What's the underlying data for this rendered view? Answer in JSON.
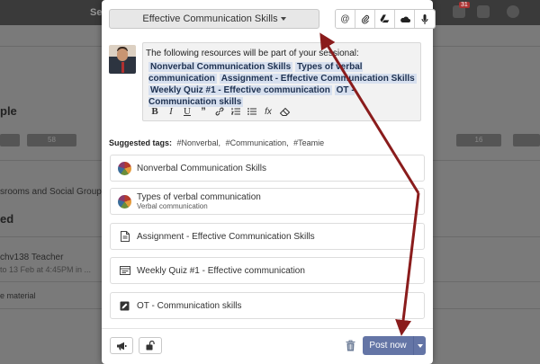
{
  "background": {
    "topbar_text": "Se",
    "badge": "31",
    "texts": [
      "ple",
      "srooms and Social Groups",
      "ed",
      "chv138 Teacher",
      "e material"
    ],
    "small_texts": [
      "to 13 Feb at 4:45PM in ..."
    ],
    "pills": [
      "58",
      "16"
    ]
  },
  "modal": {
    "target_label": "Effective Communication Skills",
    "editor": {
      "intro": "The following resources will be part of your sessional:",
      "chips": [
        "Nonverbal Communication Skills",
        "Types of verbal communication",
        "Assignment - Effective Communication Skills",
        "Weekly Quiz #1 - Effective communication",
        "OT - Communication skills"
      ],
      "toolbar": [
        "B",
        "I",
        "U",
        "99",
        "link",
        "ol",
        "ul",
        "fx",
        "eraser"
      ]
    },
    "suggested_tags": {
      "label": "Suggested tags:",
      "tags": [
        "#Nonverbal,",
        "#Communication,",
        "#Teamie"
      ]
    },
    "resources": [
      {
        "title": "Nonverbal Communication Skills",
        "subtitle": "",
        "icon": "course-thumb"
      },
      {
        "title": "Types of verbal communication",
        "subtitle": "Verbal communication",
        "icon": "course-thumb"
      },
      {
        "title": "Assignment - Effective Communication Skills",
        "subtitle": "",
        "icon": "document-icon"
      },
      {
        "title": "Weekly Quiz #1 - Effective communication",
        "subtitle": "",
        "icon": "quiz-icon"
      },
      {
        "title": "OT - Communication skills",
        "subtitle": "",
        "icon": "edit-icon"
      }
    ],
    "post_label": "Post now"
  },
  "colors": {
    "post_button": "#6475a6",
    "chip_bg": "#d7e0ef",
    "arrow": "#8a1c1c"
  }
}
